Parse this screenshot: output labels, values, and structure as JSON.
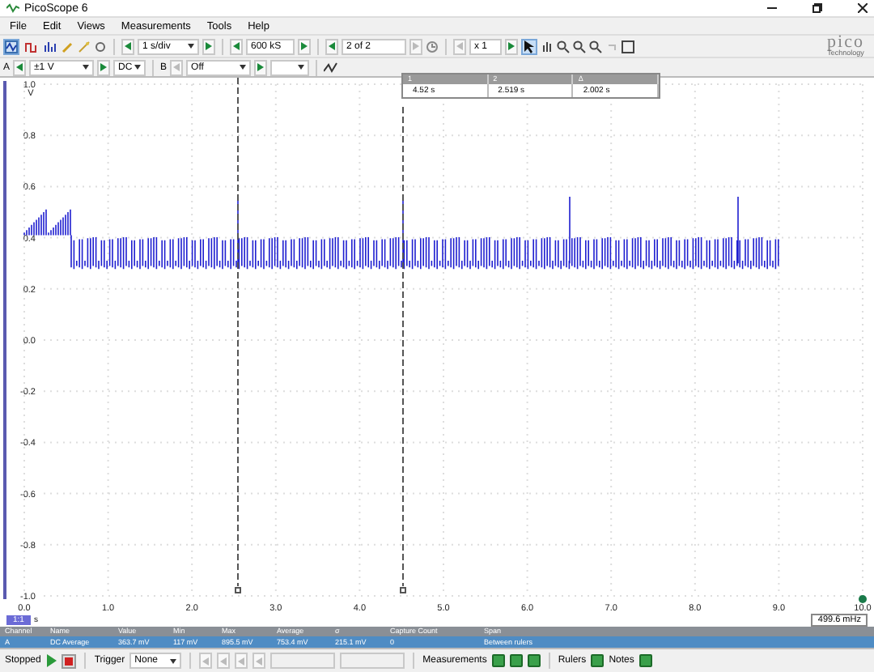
{
  "window": {
    "title": "PicoScope 6"
  },
  "menu": [
    "File",
    "Edit",
    "Views",
    "Measurements",
    "Tools",
    "Help"
  ],
  "toolbar": {
    "modes": [
      {
        "kind": "scope",
        "selected": true
      },
      {
        "kind": "persistence",
        "selected": false
      },
      {
        "kind": "spectrum",
        "selected": false
      }
    ],
    "timebase": "1 s/div",
    "samples": "600 kS",
    "buffer": "2 of 2",
    "zoom": "x 1",
    "logo": "pico",
    "logo_sub": "Technology"
  },
  "channel_bar": {
    "channel": "A",
    "range": "±1 V",
    "coupling": "DC",
    "channel_b": "B",
    "range_b": "Off"
  },
  "plot": {
    "y_unit": "V",
    "yticks": [
      "1.0",
      "0.8",
      "0.6",
      "0.4",
      "0.2",
      "0.0",
      "-0.2",
      "-0.4",
      "-0.6",
      "-0.8",
      "-1.0"
    ],
    "xticks": [
      "0.0",
      "1.0",
      "2.0",
      "3.0",
      "4.0",
      "5.0",
      "6.0",
      "7.0",
      "8.0",
      "9.0",
      "10.0"
    ],
    "x_unit": "s",
    "axis_tag": "1:1",
    "frequency": "499.6 mHz"
  },
  "ruler_table": {
    "columns": [
      "1",
      "2",
      "Δ"
    ],
    "values": [
      "4.52 s",
      "2.519 s",
      "2.002 s"
    ]
  },
  "measurements": {
    "columns": [
      "Channel",
      "Name",
      "Value",
      "Min",
      "Max",
      "Average",
      "σ",
      "Capture Count",
      "Span"
    ],
    "rows": [
      {
        "selected": true,
        "cells": [
          "A",
          "DC Average",
          "363.7 mV",
          "117 mV",
          "895.5 mV",
          "753.4 mV",
          "215.1 mV",
          "0",
          "Between rulers"
        ]
      }
    ]
  },
  "status_bar": {
    "state": "Stopped",
    "trigger_label": "Trigger",
    "trigger": "None",
    "measurements": "Measurements",
    "rulers": "Rulers",
    "notes": "Notes"
  }
}
